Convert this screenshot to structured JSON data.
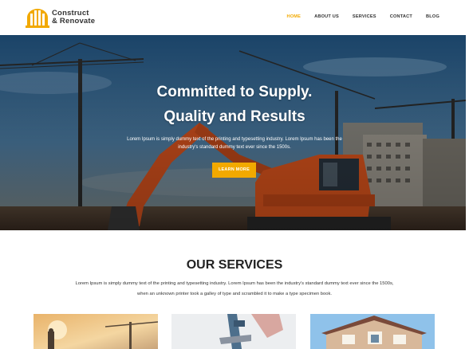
{
  "brand": {
    "name_line1": "Construct",
    "name_line2": "& Renovate"
  },
  "nav": {
    "items": [
      {
        "label": "HOME",
        "active": true
      },
      {
        "label": "ABOUT US",
        "active": false
      },
      {
        "label": "SERVICES",
        "active": false
      },
      {
        "label": "CONTACT",
        "active": false
      },
      {
        "label": "BLOG",
        "active": false
      }
    ]
  },
  "hero": {
    "title_line1": "Committed to Supply.",
    "title_line2": "Quality and Results",
    "text": "Lorem Ipsum is simply dummy text of the printing and typesetting industry. Lorem Ipsum has been the industry's standard dummy text ever since the 1500s.",
    "button_label": "LEARN MORE"
  },
  "services": {
    "title": "OUR SERVICES",
    "text": "Lorem Ipsum is simply dummy text of the printing and typesetting industry. Lorem Ipsum has been the industry's standard dummy text ever since the 1500s, when an unknown printer took a galley of type and scrambled it to make a type specimen book."
  },
  "colors": {
    "accent": "#f2a900",
    "nav_text": "#333333"
  },
  "icons": {
    "logo": "building-logo-icon"
  }
}
